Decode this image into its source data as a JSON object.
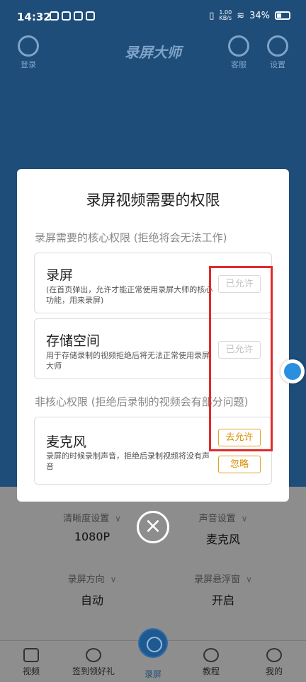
{
  "status_bar": {
    "time": "14:32",
    "speed_value": "1.00",
    "speed_unit": "KB/s",
    "battery": "34%"
  },
  "header": {
    "login": "登录",
    "title": "录屏大师",
    "service": "客服",
    "settings": "设置"
  },
  "dialog": {
    "title": "录屏视频需要的权限",
    "core_label": "录屏需要的核心权限 (拒绝将会无法工作)",
    "noncore_label": "非核心权限 (拒绝后录制的视频会有部分问题)",
    "permissions": [
      {
        "title": "录屏",
        "desc": "(在首页弹出，允许才能正常使用录屏大师的核心功能，用来录屏)",
        "button": "已允许"
      },
      {
        "title": "存储空间",
        "desc": "用于存储录制的视频拒绝后将无法正常使用录屏大师",
        "button": "已允许"
      },
      {
        "title": "麦克风",
        "desc": "录屏的时候录制声音，拒绝后录制视频将没有声音",
        "button": "去允许",
        "secondary": "忽略"
      }
    ]
  },
  "settings": {
    "clarity_label": "清晰度设置",
    "clarity_value": "1080P",
    "sound_label": "声音设置",
    "sound_value": "麦克风",
    "direction_label": "录屏方向",
    "direction_value": "自动",
    "float_label": "录屏悬浮窗",
    "float_value": "开启"
  },
  "tabs": [
    "视频",
    "签到领好礼",
    "录屏",
    "教程",
    "我的"
  ],
  "colors": {
    "accent": "#d98f00",
    "highlight": "#e02b2b",
    "brand": "#1e4d79"
  }
}
